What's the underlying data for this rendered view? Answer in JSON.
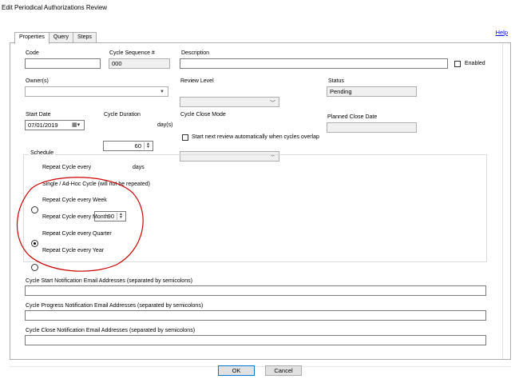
{
  "window": {
    "title": "Edit Periodical Authorizations Review",
    "help": "Help"
  },
  "tabs": [
    {
      "label": "Properties",
      "active": true
    },
    {
      "label": "Query",
      "active": false
    },
    {
      "label": "Steps",
      "active": false
    }
  ],
  "form": {
    "code": {
      "label": "Code",
      "value": ""
    },
    "cycle_seq": {
      "label": "Cycle Sequence #",
      "value": "000"
    },
    "description": {
      "label": "Description",
      "value": ""
    },
    "enabled": {
      "label": "Enabled",
      "checked": false
    },
    "owners": {
      "label": "Owner(s)",
      "value": ""
    },
    "review_level": {
      "label": "Review Level",
      "value": ""
    },
    "status": {
      "label": "Status",
      "value": "Pending"
    },
    "start_date": {
      "label": "Start Date",
      "value": "07/01/2019"
    },
    "cycle_duration": {
      "label": "Cycle Duration",
      "value": "60",
      "unit": "day(s)"
    },
    "cycle_close_mode": {
      "label": "Cycle Close Mode",
      "value": ""
    },
    "planned_close_date": {
      "label": "Planned Close Date",
      "value": ""
    },
    "auto_next": {
      "label": "Start next review automatically when cycles overlap",
      "checked": false
    }
  },
  "schedule": {
    "title": "Schedule",
    "repeat_every": {
      "label": "Repeat Cycle every",
      "value": "90",
      "unit": "days"
    },
    "options": [
      {
        "label": "Repeat Cycle every",
        "selected": false
      },
      {
        "label": "Single / Ad-Hoc Cycle (will not be repeated)",
        "selected": true
      },
      {
        "label": "Repeat Cycle every Week",
        "selected": false
      },
      {
        "label": "Repeat Cycle every Month",
        "selected": false
      },
      {
        "label": "Repeat Cycle every Quarter",
        "selected": false
      },
      {
        "label": "Repeat Cycle every Year",
        "selected": false
      }
    ]
  },
  "notifications": {
    "start": {
      "label": "Cycle Start Notification Email Addresses (separated by semicolons)",
      "value": ""
    },
    "progress": {
      "label": "Cycle Progress Notification Email Addresses (separated by semicolons)",
      "value": ""
    },
    "close": {
      "label": "Cycle Close Notification Email Addresses (separated by semicolons)",
      "value": ""
    }
  },
  "buttons": {
    "ok": "OK",
    "cancel": "Cancel"
  },
  "annotation_color": "#cc0000"
}
